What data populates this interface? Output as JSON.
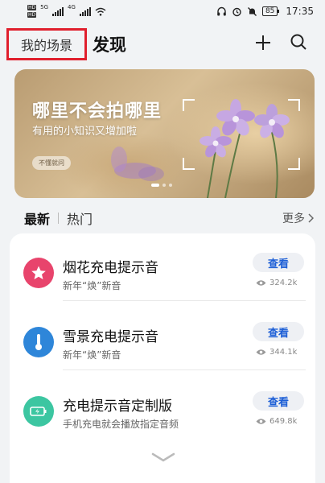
{
  "status_bar": {
    "sim1": "HD",
    "sim2": "HD",
    "net1": "5G",
    "net2": "4G",
    "battery": "85",
    "time": "17:35"
  },
  "header": {
    "scene_tab": "我的场景",
    "discover_tab": "发现"
  },
  "banner": {
    "title": "哪里不会拍哪里",
    "subtitle": "有用的小知识又增加啦",
    "tag": "不懂就问"
  },
  "section": {
    "tabs": [
      "最新",
      "热门"
    ],
    "more": "更多"
  },
  "items": [
    {
      "title": "烟花充电提示音",
      "desc": "新年“焕”新音",
      "button": "查看",
      "views": "324.2k",
      "icon": "star-icon",
      "color": "#e8446c"
    },
    {
      "title": "雪景充电提示音",
      "desc": "新年“焕”新音",
      "button": "查看",
      "views": "344.1k",
      "icon": "thermometer-icon",
      "color": "#2e86d9"
    },
    {
      "title": "充电提示音定制版",
      "desc": "手机充电就会播放指定音频",
      "button": "查看",
      "views": "649.8k",
      "icon": "battery-charging-icon",
      "color": "#3cc6a1"
    }
  ],
  "colors": {
    "highlight": "#e01f2d",
    "accent": "#1d5fd6"
  }
}
